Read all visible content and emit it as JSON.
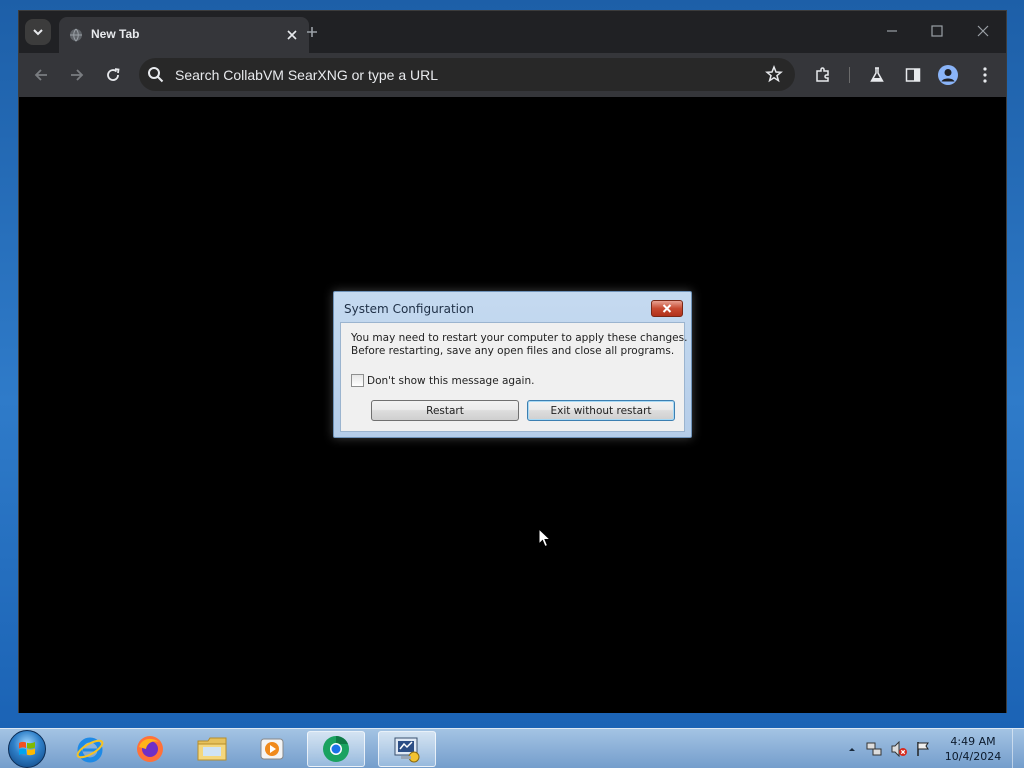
{
  "browser": {
    "tab": {
      "title": "New Tab"
    },
    "omnibox": {
      "placeholder": "Search CollabVM SearXNG or type a URL"
    }
  },
  "dialog": {
    "title": "System Configuration",
    "message": "You may need to restart your computer to apply these changes.\nBefore restarting, save any open files and close all programs.",
    "checkbox_label": "Don't show this message again.",
    "checkbox_checked": false,
    "restart_label": "Restart",
    "exit_label": "Exit without restart"
  },
  "taskbar": {
    "items": [
      "start-orb",
      "internet-explorer-icon",
      "firefox-icon",
      "file-explorer-icon",
      "media-player-icon",
      "chrome-icon",
      "msconfig-icon"
    ],
    "clock": {
      "time": "4:49 AM",
      "date": "10/4/2024"
    }
  }
}
